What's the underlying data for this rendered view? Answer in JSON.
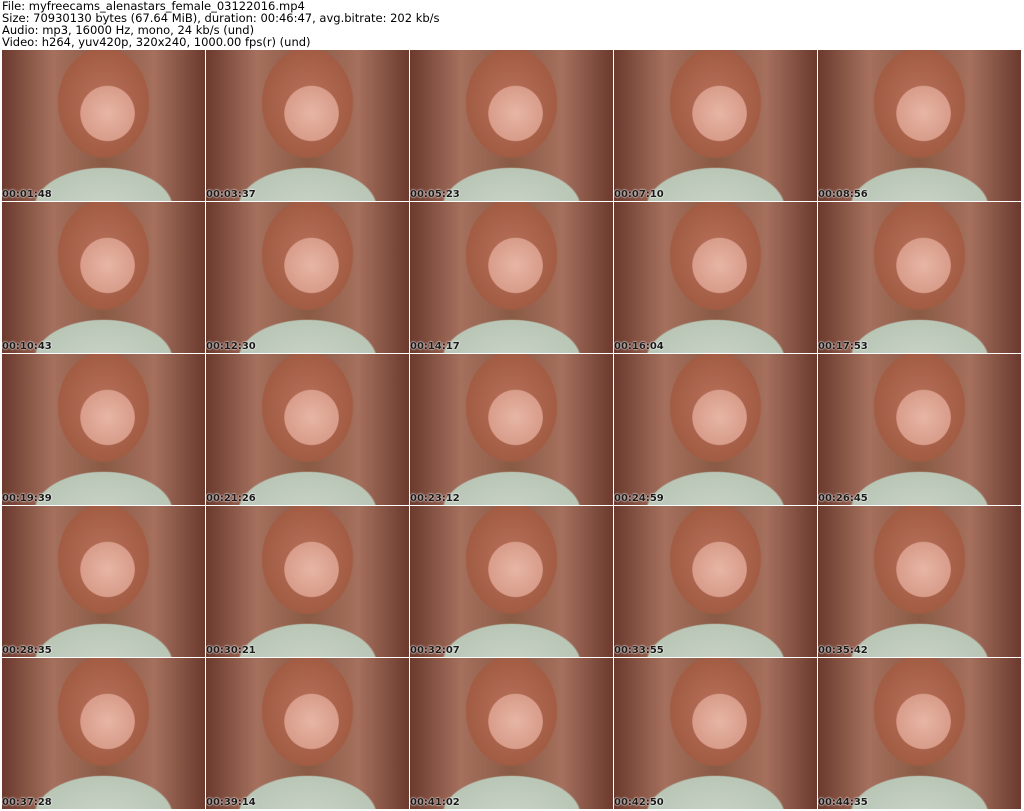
{
  "header": {
    "line1": "File: myfreecams_alenastars_female_03122016.mp4",
    "line2": "Size: 70930130 bytes (67.64 MiB), duration: 00:46:47, avg.bitrate: 202 kb/s",
    "line3": "Audio: mp3, 16000 Hz, mono, 24 kb/s (und)",
    "line4": "Video: h264, yuv420p, 320x240, 1000.00 fps(r) (und)"
  },
  "thumbnails": [
    "00:01:48",
    "00:03:37",
    "00:05:23",
    "00:07:10",
    "00:08:56",
    "00:10:43",
    "00:12:30",
    "00:14:17",
    "00:16:04",
    "00:17:53",
    "00:19:39",
    "00:21:26",
    "00:23:12",
    "00:24:59",
    "00:26:45",
    "00:28:35",
    "00:30:21",
    "00:32:07",
    "00:33:55",
    "00:35:42",
    "00:37:28",
    "00:39:14",
    "00:41:02",
    "00:42:50",
    "00:44:35"
  ]
}
